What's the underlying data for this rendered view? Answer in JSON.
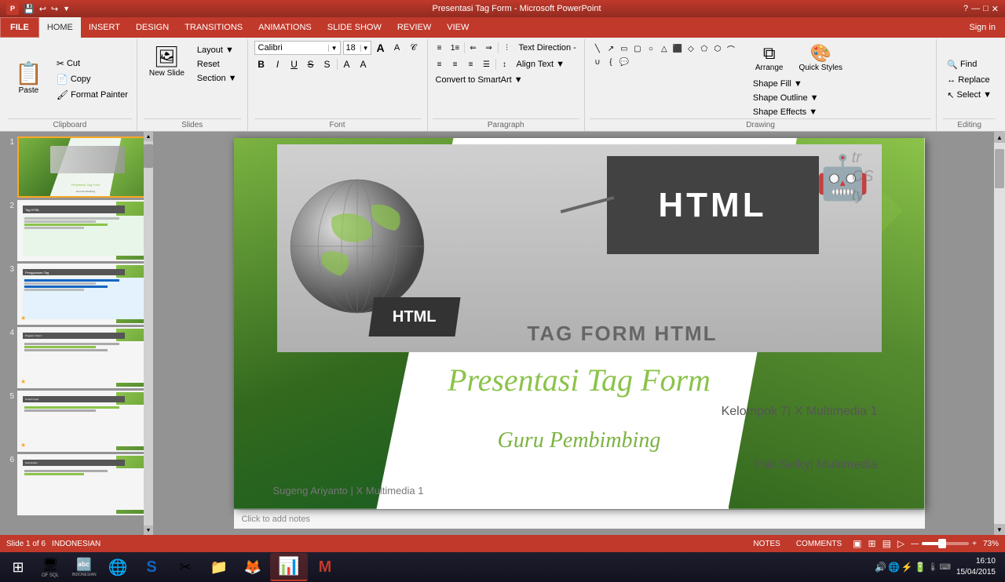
{
  "titlebar": {
    "title": "Presentasi Tag Form - Microsoft PowerPoint",
    "help": "?",
    "minimize": "—",
    "maximize": "□",
    "close": "✕"
  },
  "quickaccess": {
    "save": "💾",
    "undo": "↩",
    "redo": "↪",
    "customize": "▼"
  },
  "tabs": [
    {
      "id": "file",
      "label": "FILE"
    },
    {
      "id": "home",
      "label": "HOME",
      "active": true
    },
    {
      "id": "insert",
      "label": "INSERT"
    },
    {
      "id": "design",
      "label": "DESIGN"
    },
    {
      "id": "transitions",
      "label": "TRANSITIONS"
    },
    {
      "id": "animations",
      "label": "ANIMATIONS"
    },
    {
      "id": "slideshow",
      "label": "SLIDE SHOW"
    },
    {
      "id": "review",
      "label": "REVIEW"
    },
    {
      "id": "view",
      "label": "VIEW"
    }
  ],
  "signin": "Sign in",
  "ribbon": {
    "clipboard": {
      "label": "Clipboard",
      "paste_label": "Paste",
      "copy_label": "Copy",
      "cut_label": "Cut",
      "format_painter_label": "Format Painter"
    },
    "slides": {
      "label": "Slides",
      "new_slide_label": "New Slide",
      "layout_label": "Layout ▼",
      "reset_label": "Reset",
      "section_label": "Section ▼"
    },
    "font": {
      "label": "Font",
      "font_name": "Calibri",
      "font_size": "18",
      "grow_label": "A",
      "shrink_label": "A",
      "bold": "B",
      "italic": "I",
      "underline": "U",
      "strikethrough": "S",
      "shadow": "S",
      "font_color": "A"
    },
    "paragraph": {
      "label": "Paragraph",
      "text_direction_label": "Text Direction -",
      "align_text_label": "Align Text ▼",
      "convert_smartart_label": "Convert to SmartArt ▼"
    },
    "drawing": {
      "label": "Drawing",
      "arrange_label": "Arrange",
      "quick_styles_label": "Quick Styles",
      "shape_fill_label": "Shape Fill ▼",
      "shape_outline_label": "Shape Outline ▼",
      "shape_effects_label": "Shape Effects ▼"
    },
    "editing": {
      "label": "Editing",
      "find_label": "Find",
      "replace_label": "Replace",
      "select_label": "Select ▼"
    }
  },
  "slides": [
    {
      "num": "1",
      "active": true,
      "starred": false
    },
    {
      "num": "2",
      "starred": false
    },
    {
      "num": "3",
      "starred": true
    },
    {
      "num": "4",
      "starred": true
    },
    {
      "num": "5",
      "starred": true
    },
    {
      "num": "6",
      "starred": false
    }
  ],
  "slide": {
    "title": "Presentasi Tag Form",
    "subtitle": "Kelompok 7| X Multimedia 1",
    "guru_label": "Guru Pembimbing",
    "guru_name": "Pak Selky| Multimedia",
    "footer": "Sugeng Ariyanto | X Multimedia 1",
    "image_title": "TAG FORM HTML",
    "html_text": "HTML"
  },
  "notes": {
    "placeholder": "Click to add notes"
  },
  "statusbar": {
    "slide_info": "Slide 1 of 6",
    "language": "INDONESIAN",
    "notes_label": "NOTES",
    "comments_label": "COMMENTS",
    "view_normal": "▣",
    "view_slide_sorter": "⊞",
    "view_reading": "▤",
    "view_slideshow": "▷",
    "zoom": "73%",
    "time": "16:10",
    "date": "15/04/2015"
  },
  "taskbar": {
    "start_label": "⊞",
    "apps": [
      {
        "icon": "🖥",
        "name": "of sql"
      },
      {
        "icon": "🔤",
        "name": "indonesian"
      },
      {
        "icon": "🌐",
        "name": "browser1"
      },
      {
        "icon": "S",
        "name": "soffice",
        "color": "#1565c0"
      },
      {
        "icon": "✂",
        "name": "tool"
      },
      {
        "icon": "📁",
        "name": "file-manager"
      },
      {
        "icon": "🦊",
        "name": "firefox"
      },
      {
        "icon": "📊",
        "name": "powerpoint",
        "active": true,
        "color": "#c0392b"
      },
      {
        "icon": "M",
        "name": "msoft",
        "color": "#c0392b"
      }
    ],
    "systray": [
      "🔊",
      "🌐",
      "⚡",
      "🔋"
    ],
    "time": "16:10",
    "date": "15/04/2015"
  }
}
